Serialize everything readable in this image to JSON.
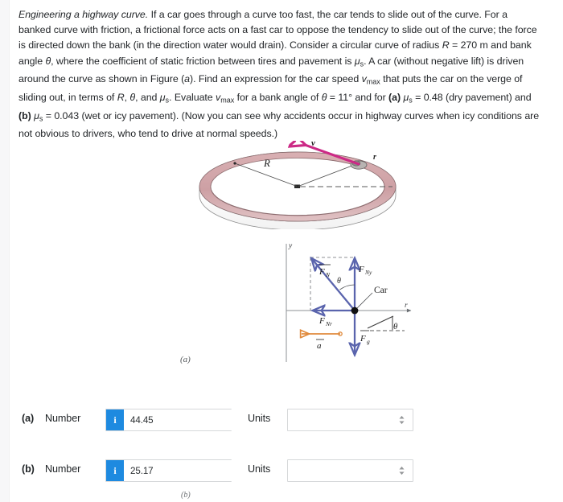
{
  "problem": {
    "lead": "Engineering a highway curve.",
    "body_plain": "If a car goes through a curve too fast, the car tends to slide out of the curve. For a banked curve with friction, a frictional force acts on a fast car to oppose the tendency to slide out of the curve; the force is directed down the bank (in the direction water would drain). Consider a circular curve of radius R = 270 m and bank angle θ, where the coefficient of static friction between tires and pavement is μs. A car (without negative lift) is driven around the curve as shown in Figure (a). Find an expression for the car speed vmax that puts the car on the verge of sliding out, in terms of R, θ, and μs. Evaluate vmax for a bank angle of θ = 11° and for (a) μs = 0.48 (dry pavement) and (b) μs = 0.043 (wet or icy pavement). (Now you can see why accidents occur in highway curves when icy conditions are not obvious to drivers, who tend to drive at normal speeds.)",
    "radius_value": "270 m",
    "bank_angle_value": "11°",
    "mu_a": "0.48",
    "mu_a_note": "dry pavement",
    "mu_b": "0.043",
    "mu_b_note": "wet or icy pavement"
  },
  "figures": {
    "fig_a": {
      "caption": "(a)",
      "labels": {
        "radius": "R",
        "velocity": "v",
        "radial": "r",
        "angle": "θ"
      },
      "colors": {
        "bank_surface": "#cfa3a6",
        "bank_surface_light": "#e2c3c5",
        "velocity_arrow": "#cc2a86",
        "outline": "#4a4a4a"
      }
    },
    "fig_b": {
      "caption": "(b)",
      "labels": {
        "y_axis": "y",
        "r_axis": "r",
        "normal_force": "F",
        "normal_force_sub": "N",
        "normal_y": "F",
        "normal_y_sub": "Ny",
        "normal_r": "F",
        "normal_r_sub": "Nr",
        "gravity": "F",
        "gravity_sub": "g",
        "acceleration": "a",
        "angle": "θ",
        "car": "Car"
      },
      "colors": {
        "vector": "#5a64ad",
        "acceleration": "#e08a3c",
        "axis": "#6b6f73"
      }
    }
  },
  "answers": {
    "rows": [
      {
        "letter": "(a)",
        "number_label": "Number",
        "info_icon": "info-icon",
        "info_glyph": "i",
        "value": "44.45",
        "placeholder": "",
        "units_label": "Units",
        "units_value": "",
        "units_placeholder": "",
        "chevron_icon": "chevron-up-down-icon"
      },
      {
        "letter": "(b)",
        "number_label": "Number",
        "info_icon": "info-icon",
        "info_glyph": "i",
        "value": "25.17",
        "placeholder": "",
        "units_label": "Units",
        "units_value": "",
        "units_placeholder": "",
        "chevron_icon": "chevron-up-down-icon"
      }
    ]
  },
  "theme": {
    "accent_blue": "#1e8ae0",
    "text": "#232629",
    "border": "#d6d8da",
    "background": "#ffffff"
  }
}
